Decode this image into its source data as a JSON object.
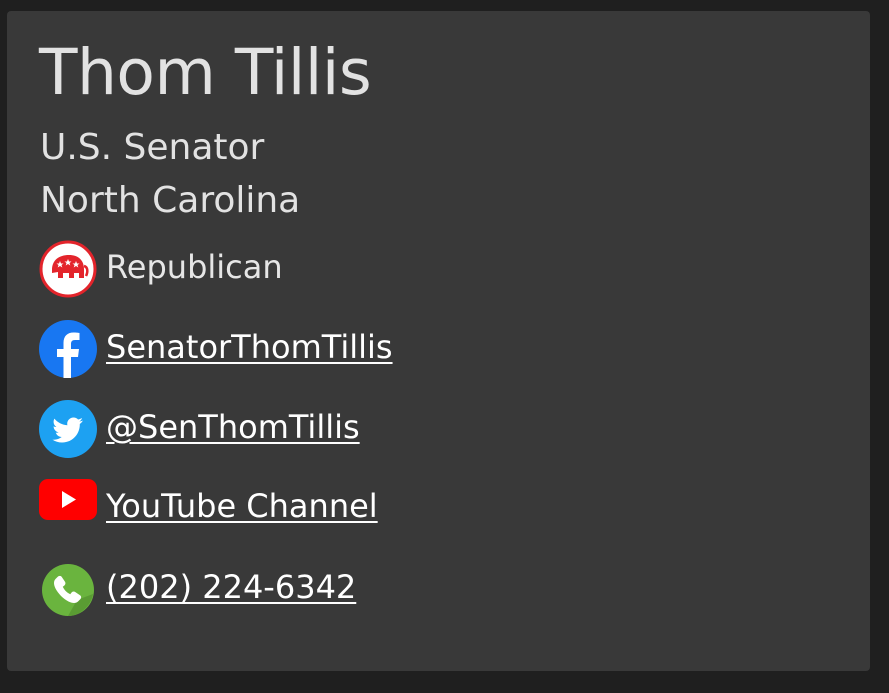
{
  "profile": {
    "name": "Thom Tillis",
    "title": "U.S. Senator",
    "state": "North Carolina",
    "party": "Republican",
    "party_icon": "republican-elephant-icon"
  },
  "links": {
    "facebook": {
      "label": "SenatorThomTillis",
      "icon": "facebook-icon"
    },
    "twitter": {
      "label": "@SenThomTillis",
      "icon": "twitter-icon"
    },
    "youtube": {
      "label": "YouTube Channel",
      "icon": "youtube-icon"
    },
    "phone": {
      "label": "(202) 224-6342",
      "icon": "phone-icon"
    }
  },
  "colors": {
    "page_background": "#1f1f1f",
    "card_background": "#393939",
    "text": "#e2e2e2",
    "republican_red": "#e3242b",
    "facebook_blue": "#1877f2",
    "twitter_blue": "#1da1f2",
    "youtube_red": "#ff0000",
    "phone_green": "#6ab43e"
  }
}
